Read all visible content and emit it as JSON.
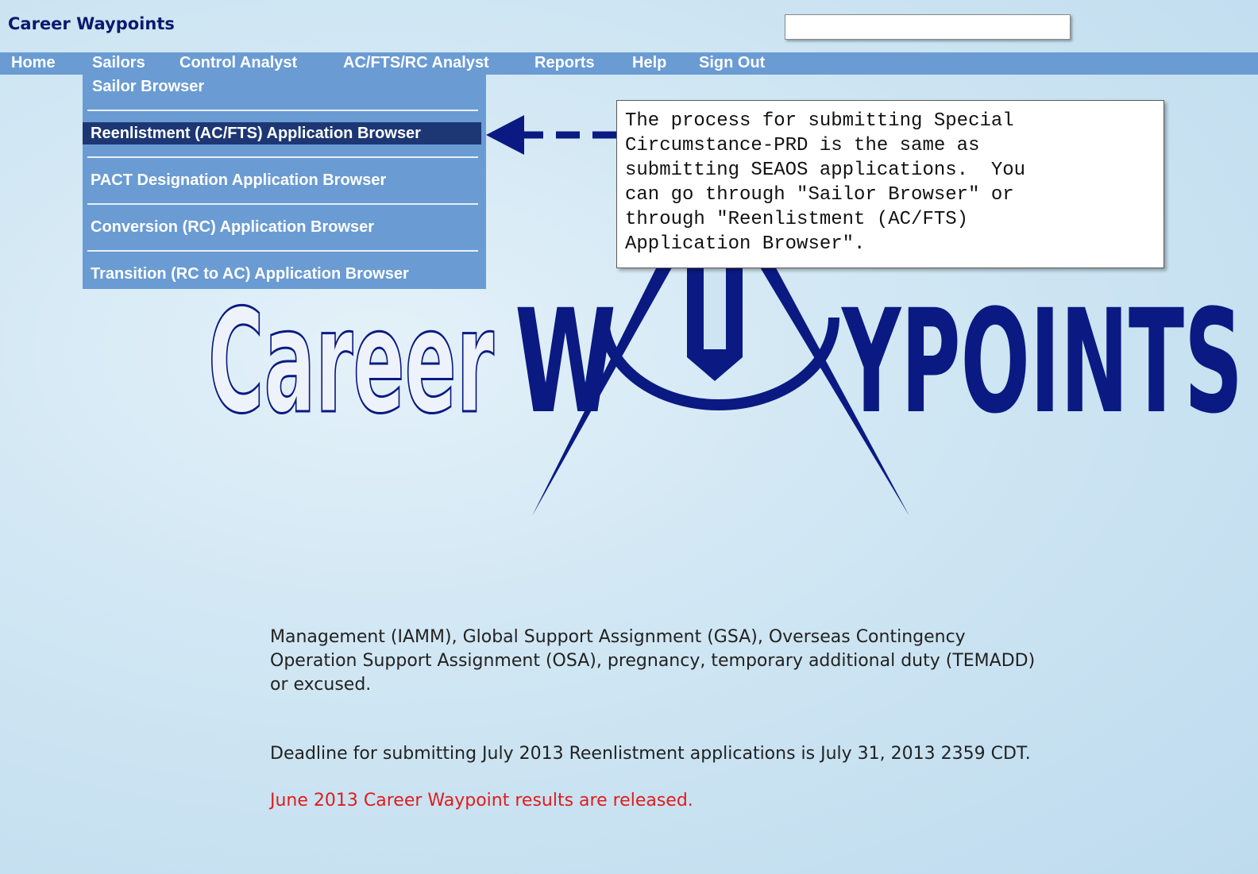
{
  "app": {
    "title": "Career Waypoints",
    "search_value": ""
  },
  "nav": {
    "items": [
      {
        "label": "Home"
      },
      {
        "label": "Sailors"
      },
      {
        "label": "Control Analyst"
      },
      {
        "label": "AC/FTS/RC Analyst"
      },
      {
        "label": "Reports"
      },
      {
        "label": "Help"
      },
      {
        "label": "Sign Out"
      }
    ]
  },
  "sailors_menu": {
    "items": [
      {
        "label": "Sailor Browser"
      },
      {
        "label": "Reenlistment (AC/FTS) Application Browser",
        "highlighted": true
      },
      {
        "label": "PACT Designation Application Browser"
      },
      {
        "label": "Conversion (RC) Application Browser"
      },
      {
        "label": "Transition (RC to AC) Application Browser"
      }
    ]
  },
  "callout": {
    "text": "The process for submitting Special\nCircumstance-PRD is the same as\nsubmitting SEAOS applications.  You\ncan go through \"Sailor Browser\" or\nthrough \"Reenlistment (AC/FTS)\nApplication Browser\"."
  },
  "logo": {
    "word1": "Career",
    "word2_left": "W",
    "word2_right": "YPOINTS"
  },
  "notices": {
    "paragraph1_line1": "Management (IAMM), Global Support Assignment (GSA), Overseas Contingency",
    "paragraph1_line2": "Operation Support Assignment (OSA), pregnancy, temporary additional duty (TEMADD)",
    "paragraph1_line3": "or excused.",
    "deadline": "Deadline for submitting July 2013 Reenlistment applications is July 31, 2013 2359 CDT.",
    "results": "June 2013 Career Waypoint results are released."
  },
  "colors": {
    "nav_bg": "#6a9bd3",
    "highlight_bg": "#1d3774",
    "title_color": "#0b1a6e",
    "logo_navy": "#0a1a82",
    "results_red": "#e01c1c"
  }
}
